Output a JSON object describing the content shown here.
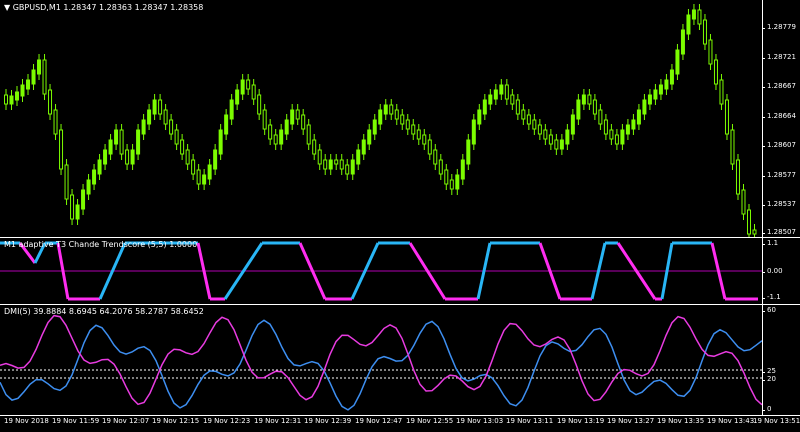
{
  "main": {
    "symbol_header": "GBPUSD,M1  1.28347 1.28363 1.28347 1.28358",
    "price_ticks": [
      "1.28779",
      "1.28721",
      "1.28667",
      "1.28664",
      "1.28607",
      "1.28577",
      "1.28537",
      "1.28507"
    ],
    "candle_color": "#7CFC00"
  },
  "trendscore": {
    "header": "M1  adaptive T3 Chande Trendscore (5,5) 1.0000",
    "scale_ticks": [
      "1.1",
      "0.00",
      "-1.1"
    ],
    "up_color": "#29B6F6",
    "down_color": "#FF2DF0"
  },
  "dmi": {
    "header": "DMI(5) 39.8884 8.6945 64.2076 58.2787 58.6452",
    "scale_ticks": [
      "60",
      "25",
      "20",
      "0"
    ],
    "plus_color": "#3D8EF0",
    "minus_color": "#E83BE0"
  },
  "time_axis": [
    "19 Nov 2018",
    "19 Nov 11:59",
    "19 Nov 12:07",
    "19 Nov 12:15",
    "19 Nov 12:23",
    "19 Nov 12:31",
    "19 Nov 12:39",
    "19 Nov 12:47",
    "19 Nov 12:55",
    "19 Nov 13:03",
    "19 Nov 13:11",
    "19 Nov 13:19",
    "19 Nov 13:27",
    "19 Nov 13:35",
    "19 Nov 13:43",
    "19 Nov 13:51"
  ]
}
